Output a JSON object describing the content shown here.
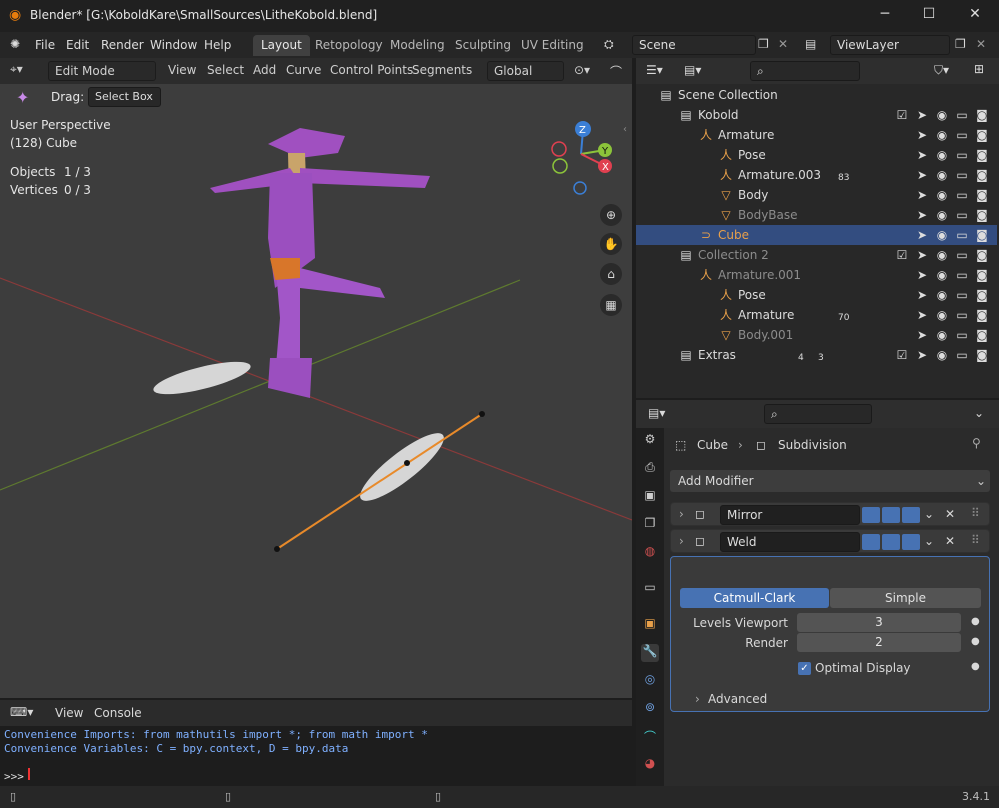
{
  "window": {
    "title": "Blender* [G:\\KoboldKare\\SmallSources\\LitheKobold.blend]",
    "minimize": "─",
    "maximize": "☐",
    "close": "✕"
  },
  "menu": {
    "items": [
      "File",
      "Edit",
      "Render",
      "Window",
      "Help"
    ],
    "tabs": [
      "Layout",
      "Retopology",
      "Modeling",
      "Sculpting",
      "UV Editing"
    ],
    "scene": "Scene",
    "viewlayer": "ViewLayer"
  },
  "viewport": {
    "mode": "Edit Mode",
    "menus": [
      "View",
      "Select",
      "Add",
      "Curve",
      "Control Points",
      "Segments"
    ],
    "orientation": "Global",
    "drag_label": "Drag:",
    "drag_value": "Select Box",
    "info_line1": "User Perspective",
    "info_line2": "(128) Cube",
    "objects_label": "Objects",
    "objects_value": "1 / 3",
    "vertices_label": "Vertices",
    "vertices_value": "0 / 3",
    "gizmo": {
      "z": "Z",
      "y": "Y",
      "x": "X"
    }
  },
  "console": {
    "menus": [
      "View",
      "Console"
    ],
    "line1": "Convenience Imports:   from mathutils import *; from math import *",
    "line2": "Convenience Variables: C = bpy.context, D = bpy.data",
    "prompt": ">>> "
  },
  "status": {
    "version": "3.4.1"
  },
  "outliner": {
    "rows": [
      {
        "label": "Scene Collection",
        "indent": 0
      },
      {
        "label": "Kobold",
        "indent": 1
      },
      {
        "label": "Armature",
        "indent": 2
      },
      {
        "label": "Pose",
        "indent": 3
      },
      {
        "label": "Armature.003",
        "indent": 3,
        "badge": "83"
      },
      {
        "label": "Body",
        "indent": 3
      },
      {
        "label": "BodyBase",
        "indent": 3,
        "dim": true
      },
      {
        "label": "Cube",
        "indent": 2,
        "selected": true
      },
      {
        "label": "Collection 2",
        "indent": 1,
        "dim": true
      },
      {
        "label": "Armature.001",
        "indent": 2,
        "dim": true
      },
      {
        "label": "Pose",
        "indent": 3
      },
      {
        "label": "Armature",
        "indent": 3,
        "badge": "70"
      },
      {
        "label": "Body.001",
        "indent": 3,
        "dim": true
      },
      {
        "label": "Extras",
        "indent": 1,
        "badge": "4",
        "badge2": "3"
      }
    ]
  },
  "properties": {
    "object": "Cube",
    "modifier": "Subdivision",
    "add_modifier": "Add Modifier",
    "modifiers": [
      "Mirror",
      "Weld",
      "Subdivision"
    ],
    "catmull": "Catmull-Clark",
    "simple": "Simple",
    "levels_viewport_label": "Levels Viewport",
    "levels_viewport": "3",
    "render_label": "Render",
    "render": "2",
    "optimal_display": "Optimal Display",
    "advanced": "Advanced"
  },
  "colors": {
    "accent": "#4772b3",
    "selected_row": "#334d80",
    "object_orange": "#e8a04a"
  }
}
